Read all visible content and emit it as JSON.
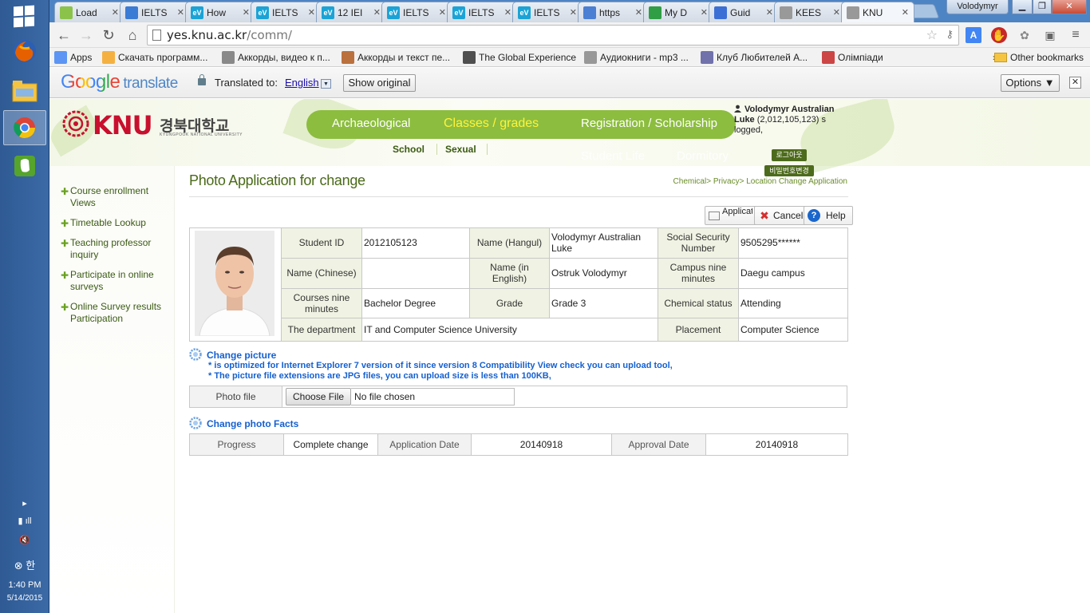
{
  "taskbar": {
    "clock_time": "1:40 PM",
    "clock_date": "5/14/2015",
    "ime_label": "한"
  },
  "browser": {
    "tabs": [
      {
        "label": "Load",
        "icon": "android-icon",
        "color": "#8bc34a"
      },
      {
        "label": "IELTS",
        "icon": "moon-icon",
        "color": "#3a7bd5"
      },
      {
        "label": "How",
        "icon": "ev-icon",
        "color": "#1ba3d6"
      },
      {
        "label": "IELTS",
        "icon": "ev-icon",
        "color": "#1ba3d6"
      },
      {
        "label": "12 IEI",
        "icon": "ev-icon",
        "color": "#1ba3d6"
      },
      {
        "label": "IELTS",
        "icon": "ev-icon",
        "color": "#1ba3d6"
      },
      {
        "label": "IELTS",
        "icon": "ev-icon",
        "color": "#1ba3d6"
      },
      {
        "label": "IELTS",
        "icon": "ev-icon",
        "color": "#1ba3d6"
      },
      {
        "label": "https",
        "icon": "google-8-icon",
        "color": "#4a7fd4"
      },
      {
        "label": "My D",
        "icon": "drive-icon",
        "color": "#2f9e44"
      },
      {
        "label": "Guid",
        "icon": "docs-icon",
        "color": "#3b6fd6"
      },
      {
        "label": "KEES",
        "icon": "page-icon",
        "color": "#999999"
      },
      {
        "label": "KNU",
        "icon": "page-icon",
        "color": "#999999"
      }
    ],
    "tab_close_glyph": "✕",
    "profile_name": "Volodymyr",
    "url_host": "yes.knu.ac.kr",
    "url_path": "/comm/",
    "bookmarks": [
      {
        "label": "Apps",
        "icon": "apps-grid-icon"
      },
      {
        "label": "Скачать программ...",
        "icon": "sun-icon"
      },
      {
        "label": "Аккорды, видео к п...",
        "icon": "guitar-icon"
      },
      {
        "label": "Аккорды и текст пе...",
        "icon": "photo-icon"
      },
      {
        "label": "The Global Experience",
        "icon": "book-icon"
      },
      {
        "label": "Аудиокниги - mp3 ...",
        "icon": "page-icon"
      },
      {
        "label": "Клуб Любителей А...",
        "icon": "chart-icon"
      },
      {
        "label": "Олімпіади",
        "icon": "cross-icon"
      }
    ],
    "bookmarks_overflow": "»",
    "other_bookmarks": "Other bookmarks"
  },
  "translate_bar": {
    "logo_google": "Google",
    "logo_translate": "translate",
    "translated_to": "Translated to:",
    "language": "English",
    "show_original": "Show original",
    "options": "Options ▼",
    "close": "✕"
  },
  "site": {
    "logo_text": "KNU",
    "logo_korean": "경북대학교",
    "logo_sub": "KYUNGPOOK NATIONAL UNIVERSITY",
    "main_nav": [
      {
        "label": "Archaeological",
        "selected": false
      },
      {
        "label": "Classes / grades",
        "selected": true
      },
      {
        "label": "Registration / Scholarship",
        "selected": false
      }
    ],
    "ghost_nav": [
      "Student Life",
      "Dormitory"
    ],
    "sub_nav": [
      "School",
      "Sexual"
    ],
    "user_name": "Volodymyr Australian Luke",
    "user_id": "(2,012,105,123)",
    "user_status": "s logged,",
    "logout_button": "로그아웃",
    "change_pw_button": "비밀번호변경",
    "left_nav": [
      "Course enrollment Views",
      "Timetable Lookup",
      "Teaching professor inquiry",
      "Participate in online surveys",
      "Online Survey results Participation"
    ],
    "left_nav_bullet": "✚",
    "page_title": "Photo Application for change",
    "breadcrumb": "Chemical> Privacy> Location Change Application",
    "buttons": {
      "apply": "Application",
      "cancel": "Cancel",
      "help": "Help"
    },
    "info": {
      "student_id_label": "Student ID",
      "student_id": "2012105123",
      "name_hangul_label": "Name (Hangul)",
      "name_hangul": "Volodymyr Australian Luke",
      "ssn_label": "Social Security Number",
      "ssn": "9505295******",
      "name_chinese_label": "Name (Chinese)",
      "name_chinese": "",
      "name_english_label": "Name (in English)",
      "name_english": "Ostruk Volodymyr",
      "campus_label": "Campus nine minutes",
      "campus": "Daegu campus",
      "courses_label": "Courses nine minutes",
      "courses": "Bachelor Degree",
      "grade_label": "Grade",
      "grade": "Grade 3",
      "chem_status_label": "Chemical status",
      "chem_status": "Attending",
      "department_label": "The department",
      "department": "IT and Computer Science University",
      "placement_label": "Placement",
      "placement": "Computer Science"
    },
    "change_picture": {
      "title": "Change picture",
      "note1": "* is optimized for Internet Explorer 7 version of it since version 8 Compatibility View check you can upload tool,",
      "note2": "* The picture file extensions are JPG files, you can upload size is less than 100KB,"
    },
    "file_row": {
      "label": "Photo file",
      "choose_button": "Choose File",
      "no_file": "No file chosen"
    },
    "facts": {
      "title": "Change photo Facts",
      "progress_label": "Progress",
      "progress_value": "Complete change",
      "app_date_label": "Application Date",
      "app_date": "20140918",
      "approval_label": "Approval Date",
      "approval_date": "20140918"
    }
  }
}
